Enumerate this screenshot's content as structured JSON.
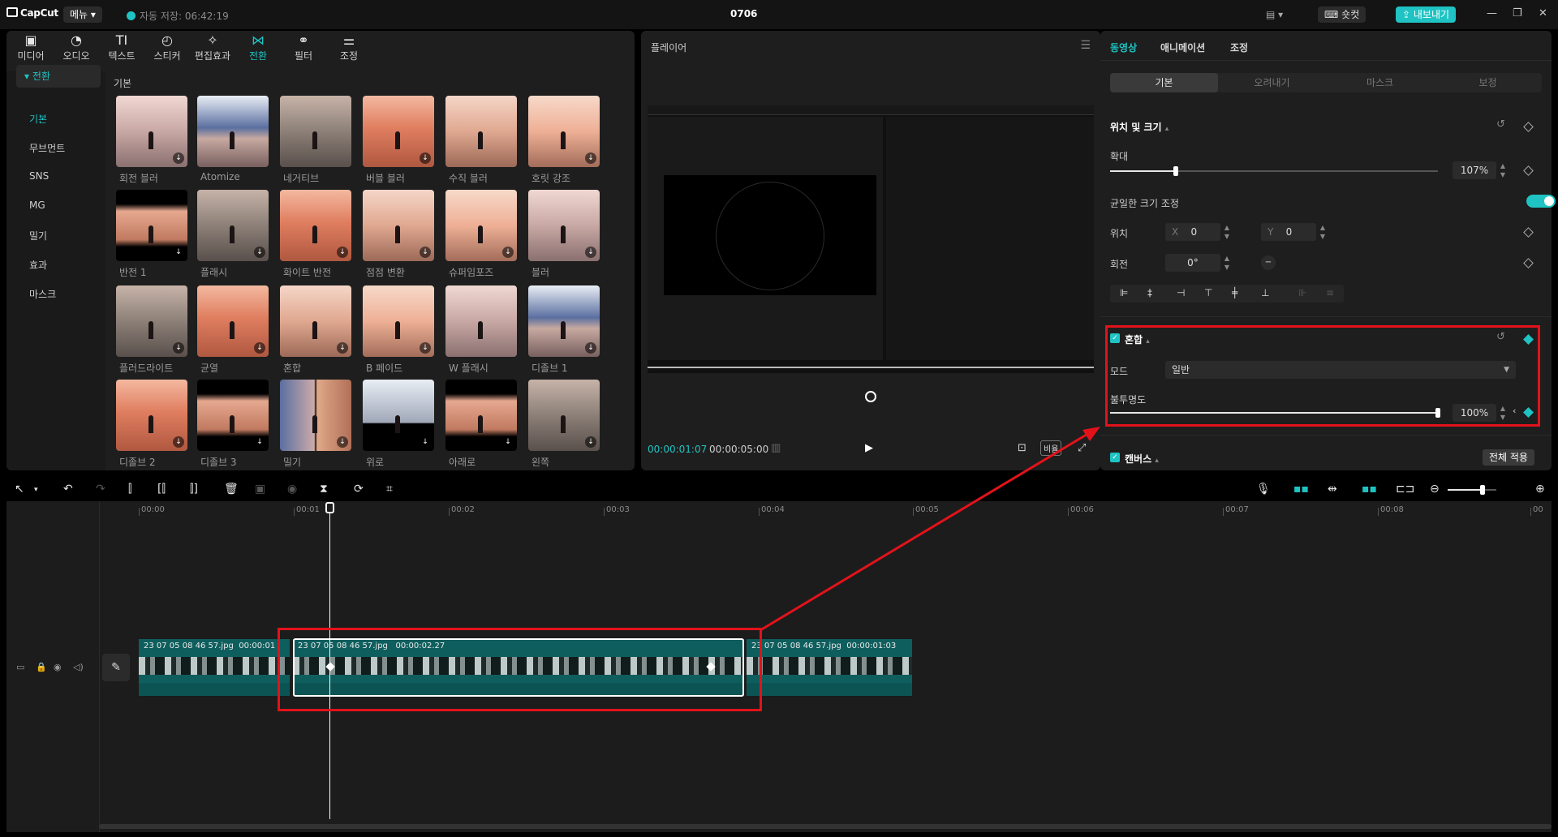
{
  "app": {
    "logo": "CapCut",
    "menu": "메뉴",
    "autosave": "자동 저장: 06:42:19",
    "title": "0706",
    "shortcut": "숏컷",
    "export": "내보내기"
  },
  "media_tabs": [
    {
      "label": "미디어",
      "icon": "media-icon"
    },
    {
      "label": "오디오",
      "icon": "audio-icon"
    },
    {
      "label": "텍스트",
      "icon": "text-icon"
    },
    {
      "label": "스티커",
      "icon": "sticker-icon"
    },
    {
      "label": "편집효과",
      "icon": "effects-icon"
    },
    {
      "label": "전환",
      "icon": "transition-icon"
    },
    {
      "label": "필터",
      "icon": "filter-icon"
    },
    {
      "label": "조정",
      "icon": "adjust-icon"
    }
  ],
  "sidebar": {
    "head": "전환",
    "items": [
      "기본",
      "무브먼트",
      "SNS",
      "MG",
      "밀기",
      "효과",
      "마스크"
    ]
  },
  "grid": {
    "title": "기본",
    "items": [
      "회전 블러",
      "Atomize",
      "네거티브",
      "버블 블러",
      "수직 블러",
      "호릿 강조",
      "반전 1",
      "플래시",
      "화이트 반전",
      "점점 변환",
      "슈퍼임포즈",
      "블러",
      "플러드라이트",
      "균열",
      "혼합",
      "B 페이드",
      "W 플래시",
      "디졸브 1",
      "디졸브 2",
      "디졸브 3",
      "밀기",
      "위로",
      "아래로",
      "왼쪽"
    ]
  },
  "player": {
    "title": "플레이어",
    "time_current": "00:00:01:07",
    "time_total": "00:00:05:00",
    "ratio": "비율"
  },
  "props": {
    "tabs": [
      "동영상",
      "애니메이션",
      "조정"
    ],
    "subtabs": [
      "기본",
      "오려내기",
      "마스크",
      "보정"
    ],
    "position_size": "위치 및 크기",
    "scale_label": "확대",
    "scale_value": "107%",
    "scale_level": 0.2,
    "uniform_label": "균일한 크기 조정",
    "position_label": "위치",
    "x_label": "X",
    "x_value": "0",
    "y_label": "Y",
    "y_value": "0",
    "rotation_label": "회전",
    "rotation_value": "0°",
    "blend_title": "혼합",
    "mode_label": "모드",
    "mode_value": "일반",
    "opacity_label": "불투명도",
    "opacity_value": "100%",
    "opacity_level": 1.0,
    "canvas_title": "캔버스",
    "apply_all": "전체 적용"
  },
  "timeline": {
    "ruler": [
      "00:00",
      "00:01",
      "00:02",
      "00:03",
      "00:04",
      "00:05",
      "00:06",
      "00:07",
      "00:08",
      "00"
    ],
    "clips": [
      {
        "name": "23 07 05 08 46 57.jpg",
        "duration": "00:00:01"
      },
      {
        "name": "23 07 05 08 46 57.jpg",
        "duration": "00:00:02.27"
      },
      {
        "name": "23 07 05 08 46 57.jpg",
        "duration": "00:00:01:03"
      }
    ]
  },
  "colors": {
    "accent": "#1fc3c3",
    "annotation": "#e3121a",
    "clip": "#0f5e5e"
  }
}
